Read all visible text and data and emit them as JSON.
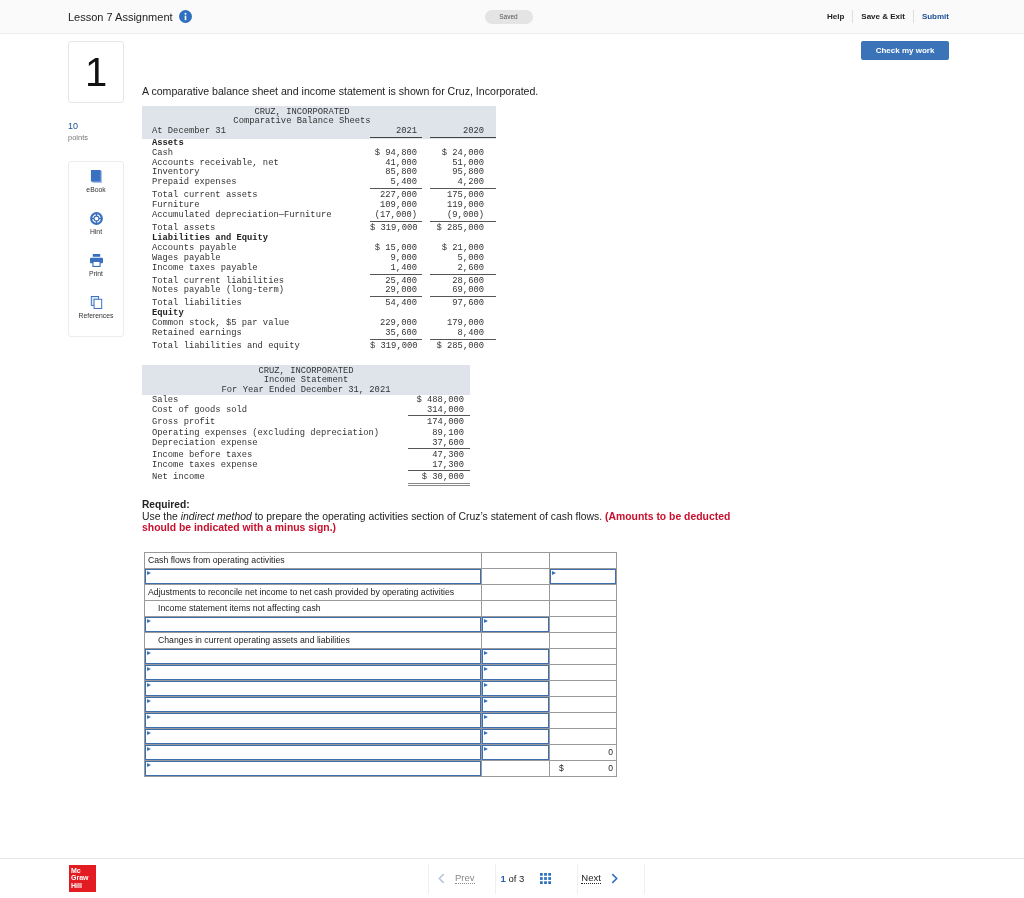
{
  "header": {
    "title": "Lesson 7 Assignment",
    "status": "Saved",
    "links": [
      {
        "label": "Help",
        "kind": "plain"
      },
      {
        "label": "Save & Exit",
        "kind": "plain"
      },
      {
        "label": "Submit",
        "kind": "primary"
      }
    ]
  },
  "question": {
    "number": "1",
    "points": "10",
    "points_label": "points",
    "check_button": "Check my work"
  },
  "tools": [
    {
      "label": "eBook",
      "kind": "book"
    },
    {
      "label": "Hint",
      "kind": "hint"
    },
    {
      "label": "Print",
      "kind": "print"
    },
    {
      "label": "References",
      "kind": "references"
    }
  ],
  "intro": "A comparative balance sheet and income statement is shown for Cruz, Incorporated.",
  "balance_sheet": {
    "title": [
      "CRUZ, INCORPORATED",
      "Comparative Balance Sheets"
    ],
    "columns": [
      "At December 31",
      "2021",
      "2020"
    ],
    "rows": [
      {
        "kind": "heading",
        "label": "Assets"
      },
      {
        "kind": "line",
        "label": "Cash",
        "values": [
          "$ 94,800",
          "$ 24,000"
        ],
        "underlined": false
      },
      {
        "kind": "line",
        "label": "Accounts receivable, net",
        "values": [
          "41,000",
          "51,000"
        ],
        "underlined": false
      },
      {
        "kind": "line",
        "label": "Inventory",
        "values": [
          "85,800",
          "95,800"
        ],
        "underlined": false
      },
      {
        "kind": "line",
        "label": "Prepaid expenses",
        "values": [
          "5,400",
          "4,200"
        ],
        "underlined": true
      },
      {
        "kind": "line",
        "label": "Total current assets",
        "values": [
          "227,000",
          "175,000"
        ],
        "underlined": false
      },
      {
        "kind": "line",
        "label": "Furniture",
        "values": [
          "109,000",
          "119,000"
        ],
        "underlined": false
      },
      {
        "kind": "line",
        "label": "Accumulated depreciation—Furniture",
        "values": [
          "(17,000)",
          "(9,000)"
        ],
        "underlined": true
      },
      {
        "kind": "line",
        "label": "Total assets",
        "values": [
          "$ 319,000",
          "$ 285,000"
        ],
        "underlined": false
      },
      {
        "kind": "heading",
        "label": "Liabilities and Equity"
      },
      {
        "kind": "line",
        "label": "Accounts payable",
        "values": [
          "$ 15,000",
          "$ 21,000"
        ],
        "underlined": false
      },
      {
        "kind": "line",
        "label": "Wages payable",
        "values": [
          "9,000",
          "5,000"
        ],
        "underlined": false
      },
      {
        "kind": "line",
        "label": "Income taxes payable",
        "values": [
          "1,400",
          "2,600"
        ],
        "underlined": true
      },
      {
        "kind": "line",
        "label": "Total current liabilities",
        "values": [
          "25,400",
          "28,600"
        ],
        "underlined": false
      },
      {
        "kind": "line",
        "label": "Notes payable (long-term)",
        "values": [
          "29,000",
          "69,000"
        ],
        "underlined": true
      },
      {
        "kind": "line",
        "label": "Total liabilities",
        "values": [
          "54,400",
          "97,600"
        ],
        "underlined": false
      },
      {
        "kind": "heading",
        "label": "Equity"
      },
      {
        "kind": "line",
        "label": "Common stock, $5 par value",
        "values": [
          "229,000",
          "179,000"
        ],
        "underlined": false
      },
      {
        "kind": "line",
        "label": "Retained earnings",
        "values": [
          "35,600",
          "8,400"
        ],
        "underlined": true
      },
      {
        "kind": "line",
        "label": "Total liabilities and equity",
        "values": [
          "$ 319,000",
          "$ 285,000"
        ],
        "underlined": false
      }
    ]
  },
  "income_statement": {
    "title": [
      "CRUZ, INCORPORATED",
      "Income Statement",
      "For Year Ended December 31, 2021"
    ],
    "rows": [
      {
        "kind": "line",
        "label": "Sales",
        "value": "$ 488,000",
        "underlined": false
      },
      {
        "kind": "line",
        "label": "Cost of goods sold",
        "value": "314,000",
        "underlined": true
      },
      {
        "kind": "line",
        "label": "Gross profit",
        "value": "174,000",
        "underlined": false
      },
      {
        "kind": "line",
        "label": "Operating expenses (excluding depreciation)",
        "value": "89,100",
        "underlined": false
      },
      {
        "kind": "line",
        "label": "Depreciation expense",
        "value": "37,600",
        "underlined": true
      },
      {
        "kind": "line",
        "label": "Income before taxes",
        "value": "47,300",
        "underlined": false
      },
      {
        "kind": "line",
        "label": "Income taxes expense",
        "value": "17,300",
        "underlined": true
      },
      {
        "kind": "total",
        "label": "Net income",
        "value": "$ 30,000"
      }
    ]
  },
  "required": {
    "heading": "Required:",
    "text": "Use the *indirect method* to prepare the operating activities section of Cruz’s statement of cash flows. **(Amounts to be deducted should be indicated with a minus sign.)**"
  },
  "answer_table": {
    "rows": [
      {
        "cells": [
          {
            "kind": "label",
            "text": "Cash flows from operating activities"
          },
          {
            "kind": "blank"
          },
          {
            "kind": "blank"
          }
        ]
      },
      {
        "cells": [
          {
            "kind": "input"
          },
          {
            "kind": "blank"
          },
          {
            "kind": "input"
          }
        ]
      },
      {
        "cells": [
          {
            "kind": "label",
            "text": "Adjustments to reconcile net income to net cash provided by operating activities"
          },
          {
            "kind": "blank"
          },
          {
            "kind": "blank"
          }
        ]
      },
      {
        "cells": [
          {
            "kind": "sublabel",
            "text": "Income statement items not affecting cash"
          },
          {
            "kind": "blank"
          },
          {
            "kind": "blank"
          }
        ]
      },
      {
        "cells": [
          {
            "kind": "input"
          },
          {
            "kind": "input"
          },
          {
            "kind": "blank"
          }
        ]
      },
      {
        "cells": [
          {
            "kind": "sublabel",
            "text": "Changes in current operating assets and liabilities"
          },
          {
            "kind": "blank"
          },
          {
            "kind": "blank"
          }
        ]
      },
      {
        "cells": [
          {
            "kind": "input"
          },
          {
            "kind": "input"
          },
          {
            "kind": "blank"
          }
        ]
      },
      {
        "cells": [
          {
            "kind": "input"
          },
          {
            "kind": "input"
          },
          {
            "kind": "blank"
          }
        ]
      },
      {
        "cells": [
          {
            "kind": "input"
          },
          {
            "kind": "input"
          },
          {
            "kind": "blank"
          }
        ]
      },
      {
        "cells": [
          {
            "kind": "input"
          },
          {
            "kind": "input"
          },
          {
            "kind": "blank"
          }
        ]
      },
      {
        "cells": [
          {
            "kind": "input"
          },
          {
            "kind": "input"
          },
          {
            "kind": "blank"
          }
        ]
      },
      {
        "cells": [
          {
            "kind": "input"
          },
          {
            "kind": "input"
          },
          {
            "kind": "blank"
          }
        ]
      },
      {
        "cells": [
          {
            "kind": "input"
          },
          {
            "kind": "input"
          },
          {
            "kind": "amount",
            "value": "0"
          }
        ]
      },
      {
        "cells": [
          {
            "kind": "input"
          },
          {
            "kind": "blank"
          },
          {
            "kind": "amount",
            "currency": "$",
            "value": "0"
          }
        ]
      }
    ]
  },
  "footer": {
    "logo": [
      "Mc",
      "Graw",
      "Hill"
    ],
    "prev": {
      "label": "Prev",
      "disabled": true
    },
    "page_indicator": "**1** of 3",
    "next": {
      "label": "Next",
      "disabled": false
    }
  }
}
